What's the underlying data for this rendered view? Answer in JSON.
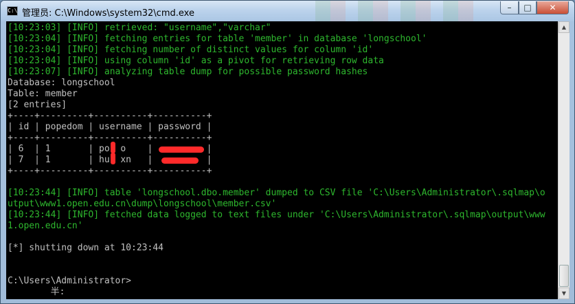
{
  "window": {
    "title": "管理员: C:\\Windows\\system32\\cmd.exe",
    "icon_label": "C:\\",
    "controls": {
      "minimize": "–",
      "maximize": "□",
      "close": "✕"
    }
  },
  "console": {
    "lines": [
      "[10:23:03] [INFO] retrieved: \"username\",\"varchar\"",
      "[10:23:04] [INFO] fetching entries for table 'member' in database 'longschool'",
      "[10:23:04] [INFO] fetching number of distinct values for column 'id'",
      "[10:23:04] [INFO] using column 'id' as a pivot for retrieving row data",
      "[10:23:07] [INFO] analyzing table dump for possible password hashes",
      "Database: longschool",
      "Table: member",
      "[2 entries]",
      "+----+---------+----------+----------+",
      "| id | popedom | username | password |",
      "+----+---------+----------+----------+",
      "| 6  | 1       | po  o    |          |",
      "| 7  | 1       | hu  xn   |          |",
      "+----+---------+----------+----------+",
      "",
      "[10:23:44] [INFO] table 'longschool.dbo.member' dumped to CSV file 'C:\\Users\\Administrator\\.sqlmap\\o",
      "utput\\www1.open.edu.cn\\dump\\longschool\\member.csv'",
      "[10:23:44] [INFO] fetched data logged to text files under 'C:\\Users\\Administrator\\.sqlmap\\output\\www",
      "1.open.edu.cn'",
      "",
      "[*] shutting down at 10:23:44",
      "",
      "",
      "C:\\Users\\Administrator>",
      "        半:"
    ]
  },
  "colors": {
    "info_text": "#2eb82e",
    "plain_text": "#c0c0c0",
    "redaction": "#ff2a2a",
    "console_bg": "#000000"
  }
}
